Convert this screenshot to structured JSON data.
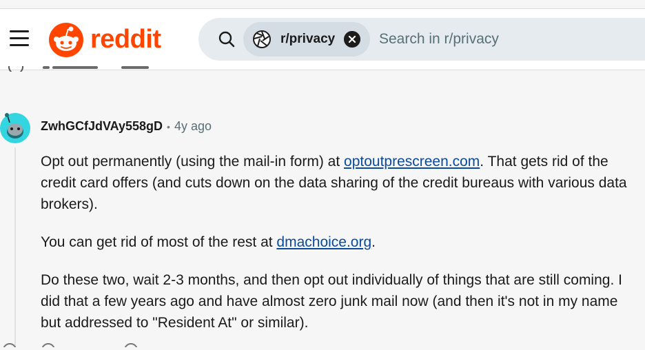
{
  "header": {
    "menu_icon": "hamburger-menu-icon",
    "logo_icon": "reddit-snoo-logo-icon",
    "wordmark": "reddit",
    "brand_color": "#ff4500",
    "search": {
      "icon": "search-icon",
      "community_chip": {
        "icon": "aperture-community-icon",
        "label": "r/privacy",
        "remove_icon": "close-icon"
      },
      "placeholder": "Search in r/privacy"
    }
  },
  "comment": {
    "avatar_icon": "snoo-avatar-icon",
    "username": "ZwhGCfJdVAy558gD",
    "separator": "•",
    "age": "4y ago",
    "paragraphs": [
      {
        "before": "Opt out permanently (using the mail-in form) at ",
        "link": "optoutprescreen.com",
        "after": ". That gets rid of the credit card offers (and cuts down on the data sharing of the credit bureaus with various data brokers)."
      },
      {
        "before": "You can get rid of most of the rest at ",
        "link": "dmachoice.org",
        "after": "."
      },
      {
        "text": "Do these two, wait 2-3 months, and then opt out individually of things that are still coming. I did that a few years ago and have almost zero junk mail now (and then it's not in my name but addressed to \"Resident At\" or similar)."
      }
    ],
    "link_color": "#0a4a9c"
  }
}
